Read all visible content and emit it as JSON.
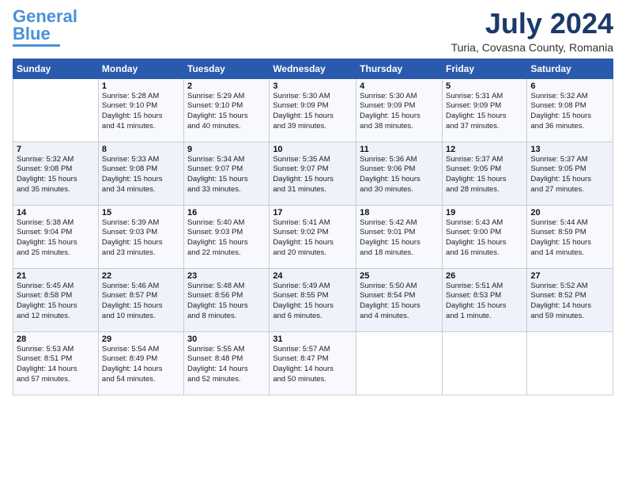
{
  "header": {
    "logo_line1": "General",
    "logo_line2": "Blue",
    "month_title": "July 2024",
    "location": "Turia, Covasna County, Romania"
  },
  "days_of_week": [
    "Sunday",
    "Monday",
    "Tuesday",
    "Wednesday",
    "Thursday",
    "Friday",
    "Saturday"
  ],
  "weeks": [
    [
      {
        "day": "",
        "detail": ""
      },
      {
        "day": "1",
        "detail": "Sunrise: 5:28 AM\nSunset: 9:10 PM\nDaylight: 15 hours\nand 41 minutes."
      },
      {
        "day": "2",
        "detail": "Sunrise: 5:29 AM\nSunset: 9:10 PM\nDaylight: 15 hours\nand 40 minutes."
      },
      {
        "day": "3",
        "detail": "Sunrise: 5:30 AM\nSunset: 9:09 PM\nDaylight: 15 hours\nand 39 minutes."
      },
      {
        "day": "4",
        "detail": "Sunrise: 5:30 AM\nSunset: 9:09 PM\nDaylight: 15 hours\nand 38 minutes."
      },
      {
        "day": "5",
        "detail": "Sunrise: 5:31 AM\nSunset: 9:09 PM\nDaylight: 15 hours\nand 37 minutes."
      },
      {
        "day": "6",
        "detail": "Sunrise: 5:32 AM\nSunset: 9:08 PM\nDaylight: 15 hours\nand 36 minutes."
      }
    ],
    [
      {
        "day": "7",
        "detail": "Sunrise: 5:32 AM\nSunset: 9:08 PM\nDaylight: 15 hours\nand 35 minutes."
      },
      {
        "day": "8",
        "detail": "Sunrise: 5:33 AM\nSunset: 9:08 PM\nDaylight: 15 hours\nand 34 minutes."
      },
      {
        "day": "9",
        "detail": "Sunrise: 5:34 AM\nSunset: 9:07 PM\nDaylight: 15 hours\nand 33 minutes."
      },
      {
        "day": "10",
        "detail": "Sunrise: 5:35 AM\nSunset: 9:07 PM\nDaylight: 15 hours\nand 31 minutes."
      },
      {
        "day": "11",
        "detail": "Sunrise: 5:36 AM\nSunset: 9:06 PM\nDaylight: 15 hours\nand 30 minutes."
      },
      {
        "day": "12",
        "detail": "Sunrise: 5:37 AM\nSunset: 9:05 PM\nDaylight: 15 hours\nand 28 minutes."
      },
      {
        "day": "13",
        "detail": "Sunrise: 5:37 AM\nSunset: 9:05 PM\nDaylight: 15 hours\nand 27 minutes."
      }
    ],
    [
      {
        "day": "14",
        "detail": "Sunrise: 5:38 AM\nSunset: 9:04 PM\nDaylight: 15 hours\nand 25 minutes."
      },
      {
        "day": "15",
        "detail": "Sunrise: 5:39 AM\nSunset: 9:03 PM\nDaylight: 15 hours\nand 23 minutes."
      },
      {
        "day": "16",
        "detail": "Sunrise: 5:40 AM\nSunset: 9:03 PM\nDaylight: 15 hours\nand 22 minutes."
      },
      {
        "day": "17",
        "detail": "Sunrise: 5:41 AM\nSunset: 9:02 PM\nDaylight: 15 hours\nand 20 minutes."
      },
      {
        "day": "18",
        "detail": "Sunrise: 5:42 AM\nSunset: 9:01 PM\nDaylight: 15 hours\nand 18 minutes."
      },
      {
        "day": "19",
        "detail": "Sunrise: 5:43 AM\nSunset: 9:00 PM\nDaylight: 15 hours\nand 16 minutes."
      },
      {
        "day": "20",
        "detail": "Sunrise: 5:44 AM\nSunset: 8:59 PM\nDaylight: 15 hours\nand 14 minutes."
      }
    ],
    [
      {
        "day": "21",
        "detail": "Sunrise: 5:45 AM\nSunset: 8:58 PM\nDaylight: 15 hours\nand 12 minutes."
      },
      {
        "day": "22",
        "detail": "Sunrise: 5:46 AM\nSunset: 8:57 PM\nDaylight: 15 hours\nand 10 minutes."
      },
      {
        "day": "23",
        "detail": "Sunrise: 5:48 AM\nSunset: 8:56 PM\nDaylight: 15 hours\nand 8 minutes."
      },
      {
        "day": "24",
        "detail": "Sunrise: 5:49 AM\nSunset: 8:55 PM\nDaylight: 15 hours\nand 6 minutes."
      },
      {
        "day": "25",
        "detail": "Sunrise: 5:50 AM\nSunset: 8:54 PM\nDaylight: 15 hours\nand 4 minutes."
      },
      {
        "day": "26",
        "detail": "Sunrise: 5:51 AM\nSunset: 8:53 PM\nDaylight: 15 hours\nand 1 minute."
      },
      {
        "day": "27",
        "detail": "Sunrise: 5:52 AM\nSunset: 8:52 PM\nDaylight: 14 hours\nand 59 minutes."
      }
    ],
    [
      {
        "day": "28",
        "detail": "Sunrise: 5:53 AM\nSunset: 8:51 PM\nDaylight: 14 hours\nand 57 minutes."
      },
      {
        "day": "29",
        "detail": "Sunrise: 5:54 AM\nSunset: 8:49 PM\nDaylight: 14 hours\nand 54 minutes."
      },
      {
        "day": "30",
        "detail": "Sunrise: 5:55 AM\nSunset: 8:48 PM\nDaylight: 14 hours\nand 52 minutes."
      },
      {
        "day": "31",
        "detail": "Sunrise: 5:57 AM\nSunset: 8:47 PM\nDaylight: 14 hours\nand 50 minutes."
      },
      {
        "day": "",
        "detail": ""
      },
      {
        "day": "",
        "detail": ""
      },
      {
        "day": "",
        "detail": ""
      }
    ]
  ]
}
